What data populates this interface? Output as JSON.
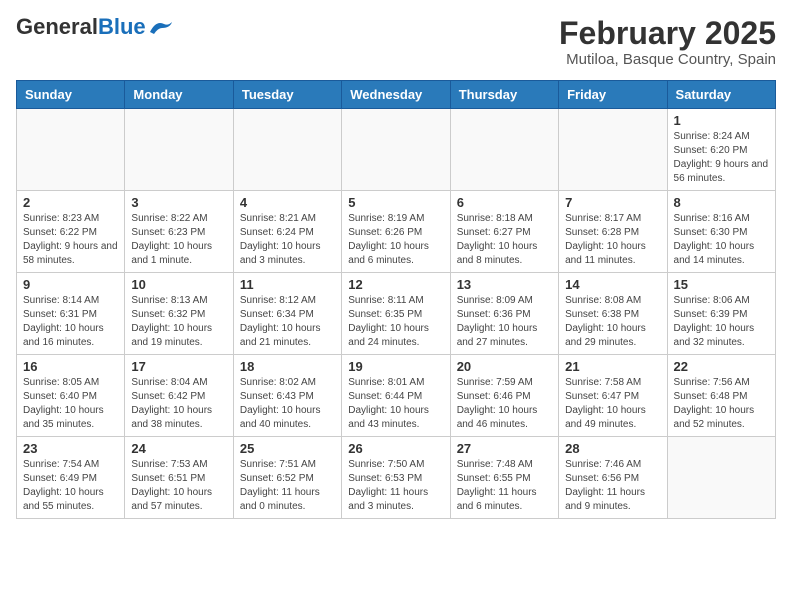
{
  "header": {
    "logo_general": "General",
    "logo_blue": "Blue",
    "title": "February 2025",
    "subtitle": "Mutiloa, Basque Country, Spain"
  },
  "weekdays": [
    "Sunday",
    "Monday",
    "Tuesday",
    "Wednesday",
    "Thursday",
    "Friday",
    "Saturday"
  ],
  "weeks": [
    [
      {
        "day": "",
        "info": ""
      },
      {
        "day": "",
        "info": ""
      },
      {
        "day": "",
        "info": ""
      },
      {
        "day": "",
        "info": ""
      },
      {
        "day": "",
        "info": ""
      },
      {
        "day": "",
        "info": ""
      },
      {
        "day": "1",
        "info": "Sunrise: 8:24 AM\nSunset: 6:20 PM\nDaylight: 9 hours and 56 minutes."
      }
    ],
    [
      {
        "day": "2",
        "info": "Sunrise: 8:23 AM\nSunset: 6:22 PM\nDaylight: 9 hours and 58 minutes."
      },
      {
        "day": "3",
        "info": "Sunrise: 8:22 AM\nSunset: 6:23 PM\nDaylight: 10 hours and 1 minute."
      },
      {
        "day": "4",
        "info": "Sunrise: 8:21 AM\nSunset: 6:24 PM\nDaylight: 10 hours and 3 minutes."
      },
      {
        "day": "5",
        "info": "Sunrise: 8:19 AM\nSunset: 6:26 PM\nDaylight: 10 hours and 6 minutes."
      },
      {
        "day": "6",
        "info": "Sunrise: 8:18 AM\nSunset: 6:27 PM\nDaylight: 10 hours and 8 minutes."
      },
      {
        "day": "7",
        "info": "Sunrise: 8:17 AM\nSunset: 6:28 PM\nDaylight: 10 hours and 11 minutes."
      },
      {
        "day": "8",
        "info": "Sunrise: 8:16 AM\nSunset: 6:30 PM\nDaylight: 10 hours and 14 minutes."
      }
    ],
    [
      {
        "day": "9",
        "info": "Sunrise: 8:14 AM\nSunset: 6:31 PM\nDaylight: 10 hours and 16 minutes."
      },
      {
        "day": "10",
        "info": "Sunrise: 8:13 AM\nSunset: 6:32 PM\nDaylight: 10 hours and 19 minutes."
      },
      {
        "day": "11",
        "info": "Sunrise: 8:12 AM\nSunset: 6:34 PM\nDaylight: 10 hours and 21 minutes."
      },
      {
        "day": "12",
        "info": "Sunrise: 8:11 AM\nSunset: 6:35 PM\nDaylight: 10 hours and 24 minutes."
      },
      {
        "day": "13",
        "info": "Sunrise: 8:09 AM\nSunset: 6:36 PM\nDaylight: 10 hours and 27 minutes."
      },
      {
        "day": "14",
        "info": "Sunrise: 8:08 AM\nSunset: 6:38 PM\nDaylight: 10 hours and 29 minutes."
      },
      {
        "day": "15",
        "info": "Sunrise: 8:06 AM\nSunset: 6:39 PM\nDaylight: 10 hours and 32 minutes."
      }
    ],
    [
      {
        "day": "16",
        "info": "Sunrise: 8:05 AM\nSunset: 6:40 PM\nDaylight: 10 hours and 35 minutes."
      },
      {
        "day": "17",
        "info": "Sunrise: 8:04 AM\nSunset: 6:42 PM\nDaylight: 10 hours and 38 minutes."
      },
      {
        "day": "18",
        "info": "Sunrise: 8:02 AM\nSunset: 6:43 PM\nDaylight: 10 hours and 40 minutes."
      },
      {
        "day": "19",
        "info": "Sunrise: 8:01 AM\nSunset: 6:44 PM\nDaylight: 10 hours and 43 minutes."
      },
      {
        "day": "20",
        "info": "Sunrise: 7:59 AM\nSunset: 6:46 PM\nDaylight: 10 hours and 46 minutes."
      },
      {
        "day": "21",
        "info": "Sunrise: 7:58 AM\nSunset: 6:47 PM\nDaylight: 10 hours and 49 minutes."
      },
      {
        "day": "22",
        "info": "Sunrise: 7:56 AM\nSunset: 6:48 PM\nDaylight: 10 hours and 52 minutes."
      }
    ],
    [
      {
        "day": "23",
        "info": "Sunrise: 7:54 AM\nSunset: 6:49 PM\nDaylight: 10 hours and 55 minutes."
      },
      {
        "day": "24",
        "info": "Sunrise: 7:53 AM\nSunset: 6:51 PM\nDaylight: 10 hours and 57 minutes."
      },
      {
        "day": "25",
        "info": "Sunrise: 7:51 AM\nSunset: 6:52 PM\nDaylight: 11 hours and 0 minutes."
      },
      {
        "day": "26",
        "info": "Sunrise: 7:50 AM\nSunset: 6:53 PM\nDaylight: 11 hours and 3 minutes."
      },
      {
        "day": "27",
        "info": "Sunrise: 7:48 AM\nSunset: 6:55 PM\nDaylight: 11 hours and 6 minutes."
      },
      {
        "day": "28",
        "info": "Sunrise: 7:46 AM\nSunset: 6:56 PM\nDaylight: 11 hours and 9 minutes."
      },
      {
        "day": "",
        "info": ""
      }
    ]
  ]
}
